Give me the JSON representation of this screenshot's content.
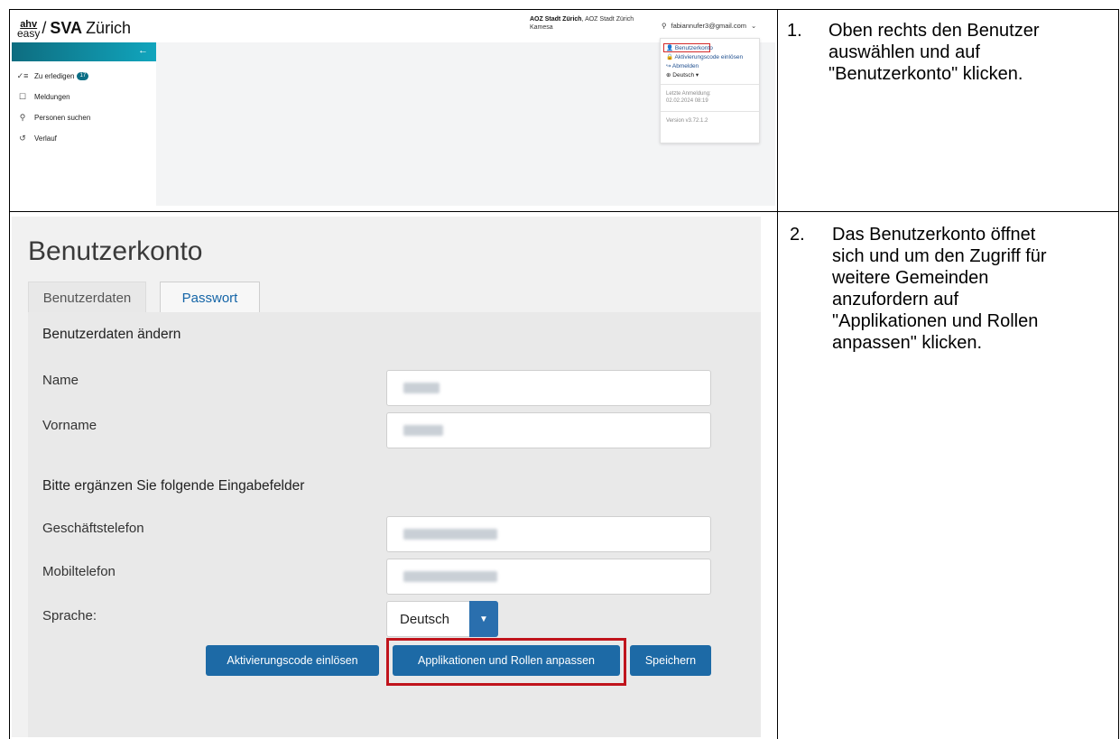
{
  "steps": [
    {
      "number": "1.",
      "lines": [
        "Oben rechts den Benutzer",
        "auswählen und auf",
        "\"Benutzerkonto\" klicken."
      ]
    },
    {
      "number": "2.",
      "lines": [
        "Das Benutzerkonto öffnet",
        "sich und um den Zugriff für",
        "weitere Gemeinden",
        "anzufordern auf",
        "\"Applikationen und Rollen",
        "anpassen\" klicken."
      ]
    }
  ],
  "app1": {
    "logo": {
      "ahv": "ahv",
      "easy": "easy",
      "slash": "/",
      "brand": "SVA",
      "city": "Zürich"
    },
    "org": {
      "bold": "AOZ Stadt Zürich",
      "rest": ", AOZ Stadt Zürich",
      "line2": "Kamesa"
    },
    "user_email": "fabiannufer3@gmail.com",
    "nav": [
      {
        "icon": "✓≡",
        "label": "Zu erledigen",
        "badge": "17"
      },
      {
        "icon": "☐",
        "label": "Meldungen"
      },
      {
        "icon": "⚲",
        "label": "Personen suchen"
      },
      {
        "icon": "↺",
        "label": "Verlauf"
      }
    ],
    "collapse_glyph": "←",
    "dropdown": {
      "items": [
        "Benutzerkonto",
        "Aktivierungscode einlösen",
        "Abmelden",
        "Deutsch ▾"
      ],
      "last_login_label": "Letzte Anmeldung:",
      "last_login_value": "02.02.2024 08:19",
      "version": "Version v3.72.1.2"
    }
  },
  "app2": {
    "title": "Benutzerkonto",
    "tabs": [
      "Benutzerdaten",
      "Passwort"
    ],
    "section1": "Benutzerdaten ändern",
    "labels": {
      "name": "Name",
      "vorname": "Vorname",
      "geschaeftstelefon": "Geschäftstelefon",
      "mobiltelefon": "Mobiltelefon",
      "sprache": "Sprache:"
    },
    "section2": "Bitte ergänzen Sie folgende Eingabefelder",
    "sprache_value": "Deutsch",
    "buttons": {
      "activation": "Aktivierungscode einlösen",
      "apps": "Applikationen und Rollen anpassen",
      "save": "Speichern"
    }
  },
  "colors": {
    "accent": "#1d6aa6",
    "highlight": "#c0141c",
    "sidebar_head": "#0e6d80"
  }
}
